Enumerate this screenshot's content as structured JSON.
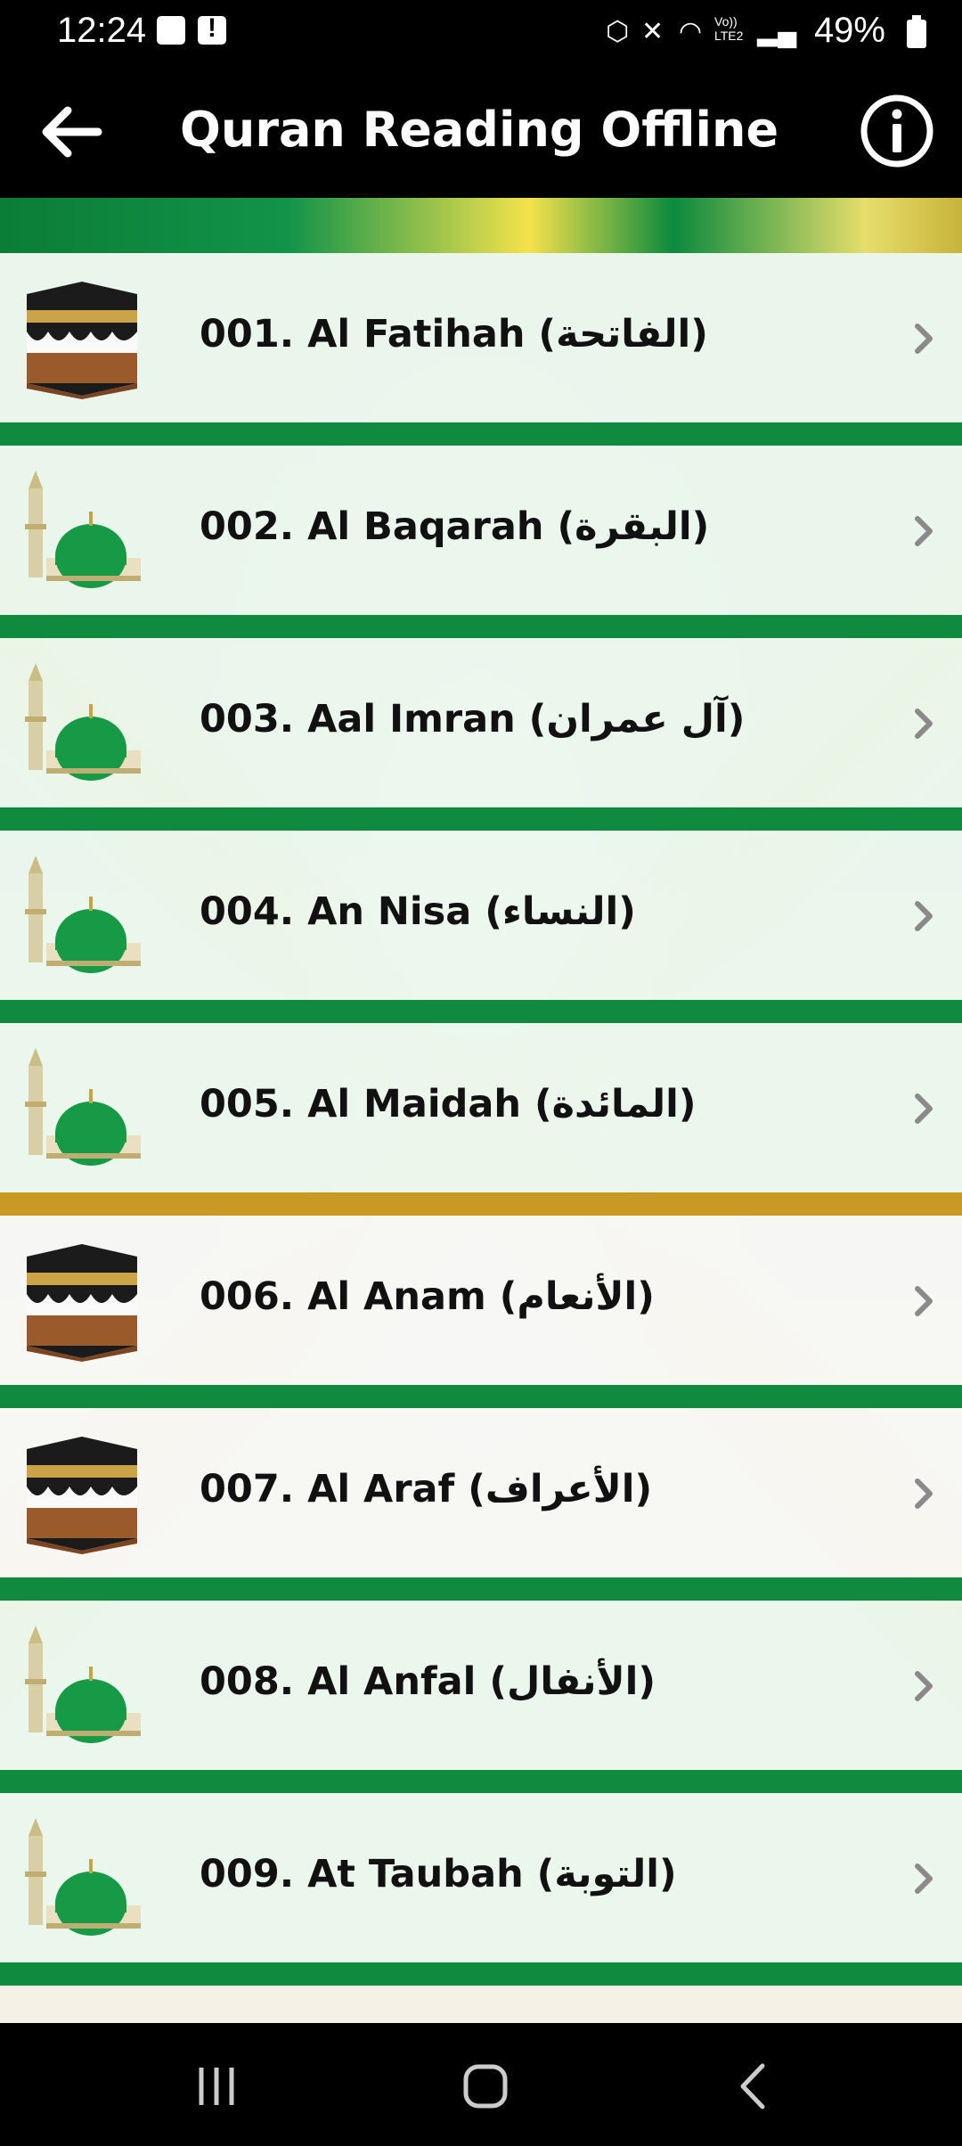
{
  "status_bar": {
    "time": "12:24",
    "battery": "49%",
    "icons": [
      "image-notification-icon",
      "alert-notification-icon",
      "bluetooth-battery-icon",
      "mute-icon",
      "wifi-icon",
      "volte-icon",
      "signal-icon",
      "battery-icon"
    ],
    "network_label": "Vo)) LTE2"
  },
  "app_bar": {
    "title": "Quran Reading Offline",
    "back_icon": "arrow-left-icon",
    "info_icon": "info-icon"
  },
  "surahs": [
    {
      "label": "001. Al Fatihah (الفاتحة)",
      "image": "kaaba"
    },
    {
      "label": "002. Al Baqarah (البقرة)",
      "image": "green-dome"
    },
    {
      "label": "003. Aal Imran (آل عمران)",
      "image": "green-dome"
    },
    {
      "label": "004. An Nisa (النساء)",
      "image": "green-dome"
    },
    {
      "label": "005. Al Maidah (المائدة)",
      "image": "green-dome"
    },
    {
      "label": "006. Al Anam (الأنعام)",
      "image": "kaaba"
    },
    {
      "label": "007. Al Araf (الأعراف)",
      "image": "kaaba"
    },
    {
      "label": "008. Al Anfal (الأنفال)",
      "image": "green-dome"
    },
    {
      "label": "009. At Taubah (التوبة)",
      "image": "green-dome"
    }
  ],
  "nav_bar": {
    "buttons": [
      "recent-apps-icon",
      "home-icon",
      "back-icon"
    ]
  },
  "colors": {
    "accent_green": "#0f8a3e",
    "bar_background": "#000000",
    "dome_green": "#169a45",
    "kaaba_gold": "#caa447"
  }
}
